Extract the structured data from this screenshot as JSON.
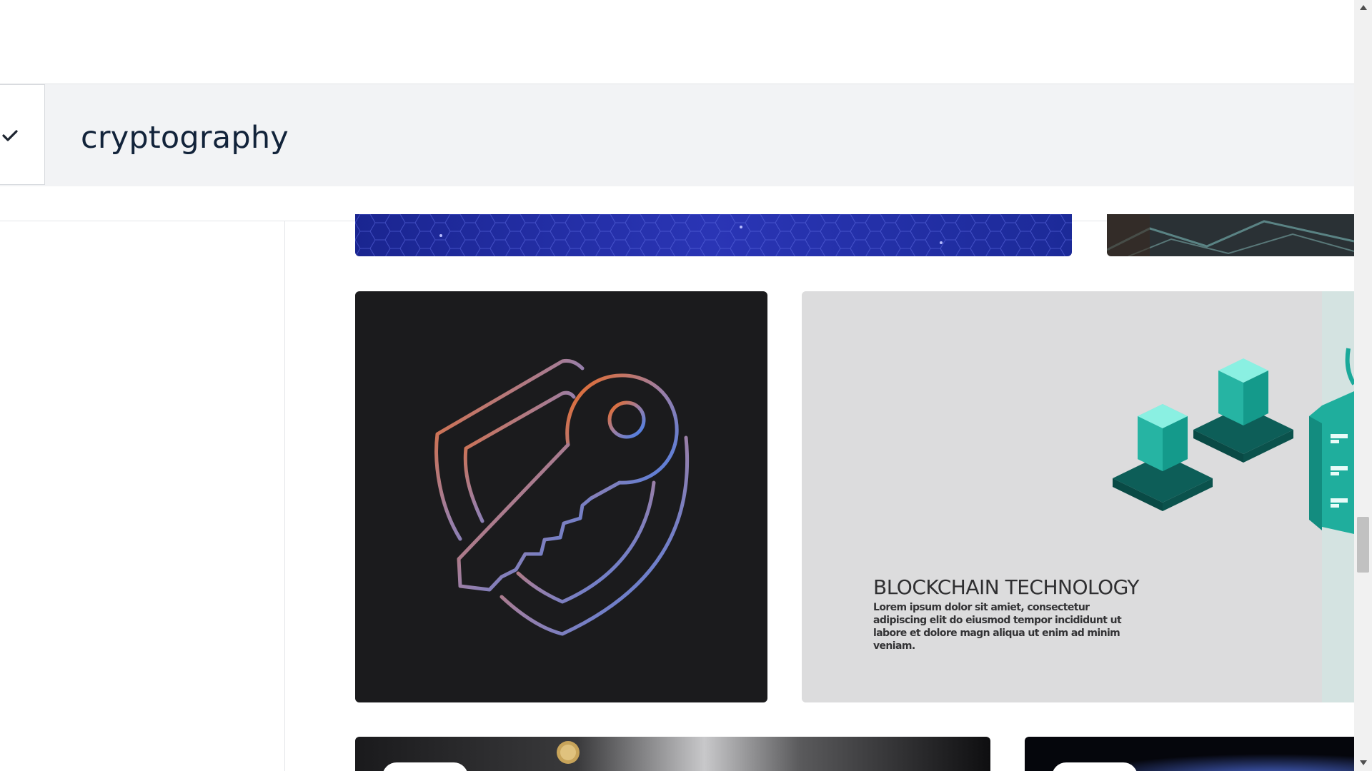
{
  "search": {
    "query": "cryptography"
  },
  "results": {
    "cards": [
      {
        "name": "blue-hexagon-network-image",
        "art": "hexagon-pattern"
      },
      {
        "name": "circuit-board-image",
        "art": "circuit"
      },
      {
        "name": "neon-key-shield-image",
        "art": "key-shield-icon"
      },
      {
        "name": "blockchain-technology-image",
        "art": "isometric-cubes",
        "title": "BLOCKCHAIN TECHNOLOGY",
        "body": "Lorem ipsum dolor sit amiet, consectetur adipiscing elit do eiusmod tempor incididunt ut labore et dolore magn aliqua ut enim ad minim veniam."
      },
      {
        "name": "crypto-coins-photo",
        "art": "coins"
      },
      {
        "name": "space-glow-image",
        "art": "space"
      }
    ]
  },
  "colors": {
    "header_bg": "#f2f3f5",
    "query_text": "#12233a",
    "card_dark": "#1b1b1d",
    "card_light": "#dcdcdd",
    "hex_blue": "#2430a8",
    "key_orange": "#f06a1c",
    "key_blue": "#3f7ff0",
    "teal": "#1aa99a"
  }
}
